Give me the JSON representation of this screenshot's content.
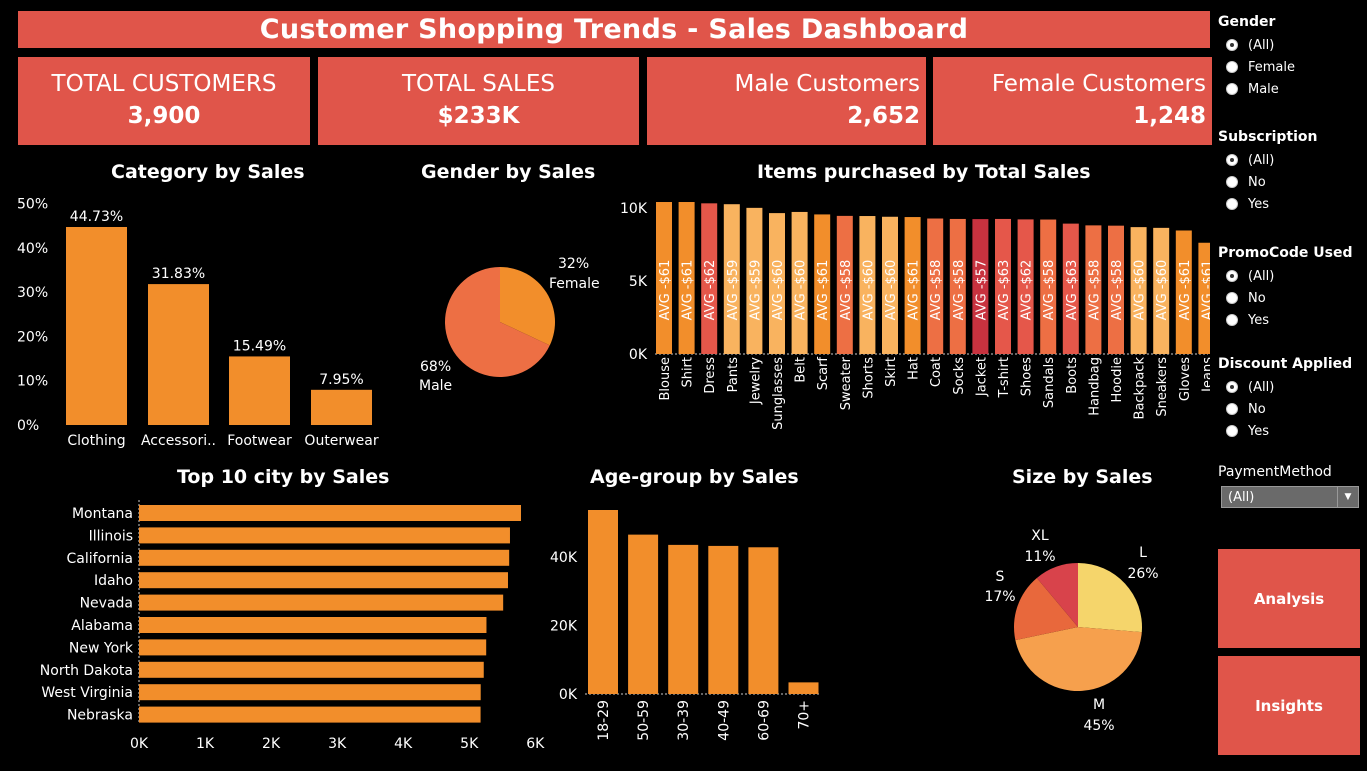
{
  "header": {
    "title": "Customer Shopping Trends - Sales Dashboard"
  },
  "kpis": [
    {
      "label": "TOTAL CUSTOMERS",
      "value": "3,900"
    },
    {
      "label": "TOTAL SALES",
      "value": "$233K"
    },
    {
      "label": "Male Customers",
      "value": "2,652"
    },
    {
      "label": "Female Customers",
      "value": "1,248"
    }
  ],
  "category_chart": {
    "title": "Category by Sales",
    "yticks": [
      "50%",
      "40%",
      "30%",
      "20%",
      "10%",
      "0%"
    ]
  },
  "gender_chart": {
    "title": "Gender by Sales"
  },
  "items_chart": {
    "title": "Items purchased by Total Sales",
    "yticks": [
      "10K",
      "5K",
      "0K"
    ]
  },
  "city_chart": {
    "title": "Top 10 city by Sales",
    "xticks": [
      "0K",
      "1K",
      "2K",
      "3K",
      "4K",
      "5K",
      "6K"
    ]
  },
  "age_chart": {
    "title": "Age-group by Sales",
    "yticks": [
      "40K",
      "20K",
      "0K"
    ]
  },
  "size_chart": {
    "title": "Size by Sales"
  },
  "filters": {
    "gender": {
      "title": "Gender",
      "options": [
        "(All)",
        "Female",
        "Male"
      ],
      "selected": 0
    },
    "subscription": {
      "title": "Subscription",
      "options": [
        "(All)",
        "No",
        "Yes"
      ],
      "selected": 0
    },
    "promo": {
      "title": "PromoCode Used",
      "options": [
        "(All)",
        "No",
        "Yes"
      ],
      "selected": 0
    },
    "discount": {
      "title": "Discount Applied",
      "options": [
        "(All)",
        "No",
        "Yes"
      ],
      "selected": 0
    },
    "payment": {
      "title": "PaymentMethod",
      "value": "(All)"
    }
  },
  "buttons": {
    "analysis": "Analysis",
    "insights": "Insights"
  },
  "colors": {
    "accent": "#e0554a",
    "orange": "#f28e2b",
    "light_orange": "#f9b35f",
    "red": "#c8323f",
    "yellow": "#f5d56b",
    "pie_orange": "#ed6f44",
    "size_m": "#f6a04d",
    "size_s": "#e8683c",
    "size_xl": "#d8434b"
  },
  "chart_data": [
    {
      "type": "bar",
      "name": "category",
      "categories": [
        "Clothing",
        "Accessori..",
        "Footwear",
        "Outerwear"
      ],
      "values": [
        44.73,
        31.83,
        15.49,
        7.95
      ],
      "labels": [
        "44.73%",
        "31.83%",
        "15.49%",
        "7.95%"
      ],
      "title": "Category by Sales",
      "ylim": [
        0,
        50
      ]
    },
    {
      "type": "pie",
      "name": "gender",
      "categories": [
        "Female",
        "Male"
      ],
      "values": [
        32,
        68
      ],
      "labels": [
        "32%",
        "68%"
      ],
      "title": "Gender by Sales"
    },
    {
      "type": "bar",
      "name": "items",
      "categories": [
        "Blouse",
        "Shirt",
        "Dress",
        "Pants",
        "Jewelry",
        "Sunglasses",
        "Belt",
        "Scarf",
        "Sweater",
        "Shorts",
        "Skirt",
        "Hat",
        "Coat",
        "Socks",
        "Jacket",
        "T-shirt",
        "Shoes",
        "Sandals",
        "Boots",
        "Handbag",
        "Hoodie",
        "Backpack",
        "Sneakers",
        "Gloves",
        "Jeans"
      ],
      "values": [
        10410,
        10410,
        10320,
        10260,
        10010,
        9650,
        9730,
        9560,
        9460,
        9450,
        9400,
        9380,
        9280,
        9250,
        9240,
        9250,
        9220,
        9210,
        8930,
        8810,
        8790,
        8690,
        8640,
        8460,
        7620
      ],
      "avg_labels": [
        "AVG -$61",
        "AVG -$61",
        "AVG -$62",
        "AVG -$59",
        "AVG -$59",
        "AVG -$60",
        "AVG -$60",
        "AVG -$61",
        "AVG -$58",
        "AVG -$60",
        "AVG -$60",
        "AVG -$61",
        "AVG -$58",
        "AVG -$58",
        "AVG -$57",
        "AVG -$63",
        "AVG -$62",
        "AVG -$58",
        "AVG -$63",
        "AVG -$58",
        "AVG -$58",
        "AVG -$60",
        "AVG -$60",
        "AVG -$61",
        "AVG -$61"
      ],
      "avg_values": [
        61,
        61,
        62,
        59,
        59,
        60,
        60,
        61,
        58,
        60,
        60,
        61,
        58,
        58,
        57,
        63,
        62,
        58,
        63,
        58,
        58,
        60,
        60,
        61,
        61
      ],
      "title": "Items purchased by Total Sales",
      "ylim": [
        0,
        11000
      ]
    },
    {
      "type": "bar",
      "name": "city",
      "orientation": "horizontal",
      "categories": [
        "Montana",
        "Illinois",
        "California",
        "Idaho",
        "Nevada",
        "Alabama",
        "New York",
        "North Dakota",
        "West Virginia",
        "Nebraska"
      ],
      "values": [
        5784,
        5617,
        5605,
        5587,
        5514,
        5261,
        5257,
        5220,
        5174,
        5172
      ],
      "title": "Top 10 city by Sales",
      "xlim": [
        0,
        6000
      ]
    },
    {
      "type": "bar",
      "name": "age",
      "categories": [
        "18-29",
        "50-59",
        "30-39",
        "40-49",
        "60-69",
        "70+"
      ],
      "values": [
        53800,
        46600,
        43600,
        43300,
        42900,
        3400
      ],
      "title": "Age-group by Sales",
      "ylim": [
        0,
        55000
      ]
    },
    {
      "type": "pie",
      "name": "size",
      "categories": [
        "L",
        "M",
        "S",
        "XL"
      ],
      "values": [
        26,
        45,
        17,
        11
      ],
      "labels": [
        "26%",
        "45%",
        "17%",
        "11%"
      ],
      "title": "Size by Sales"
    }
  ]
}
